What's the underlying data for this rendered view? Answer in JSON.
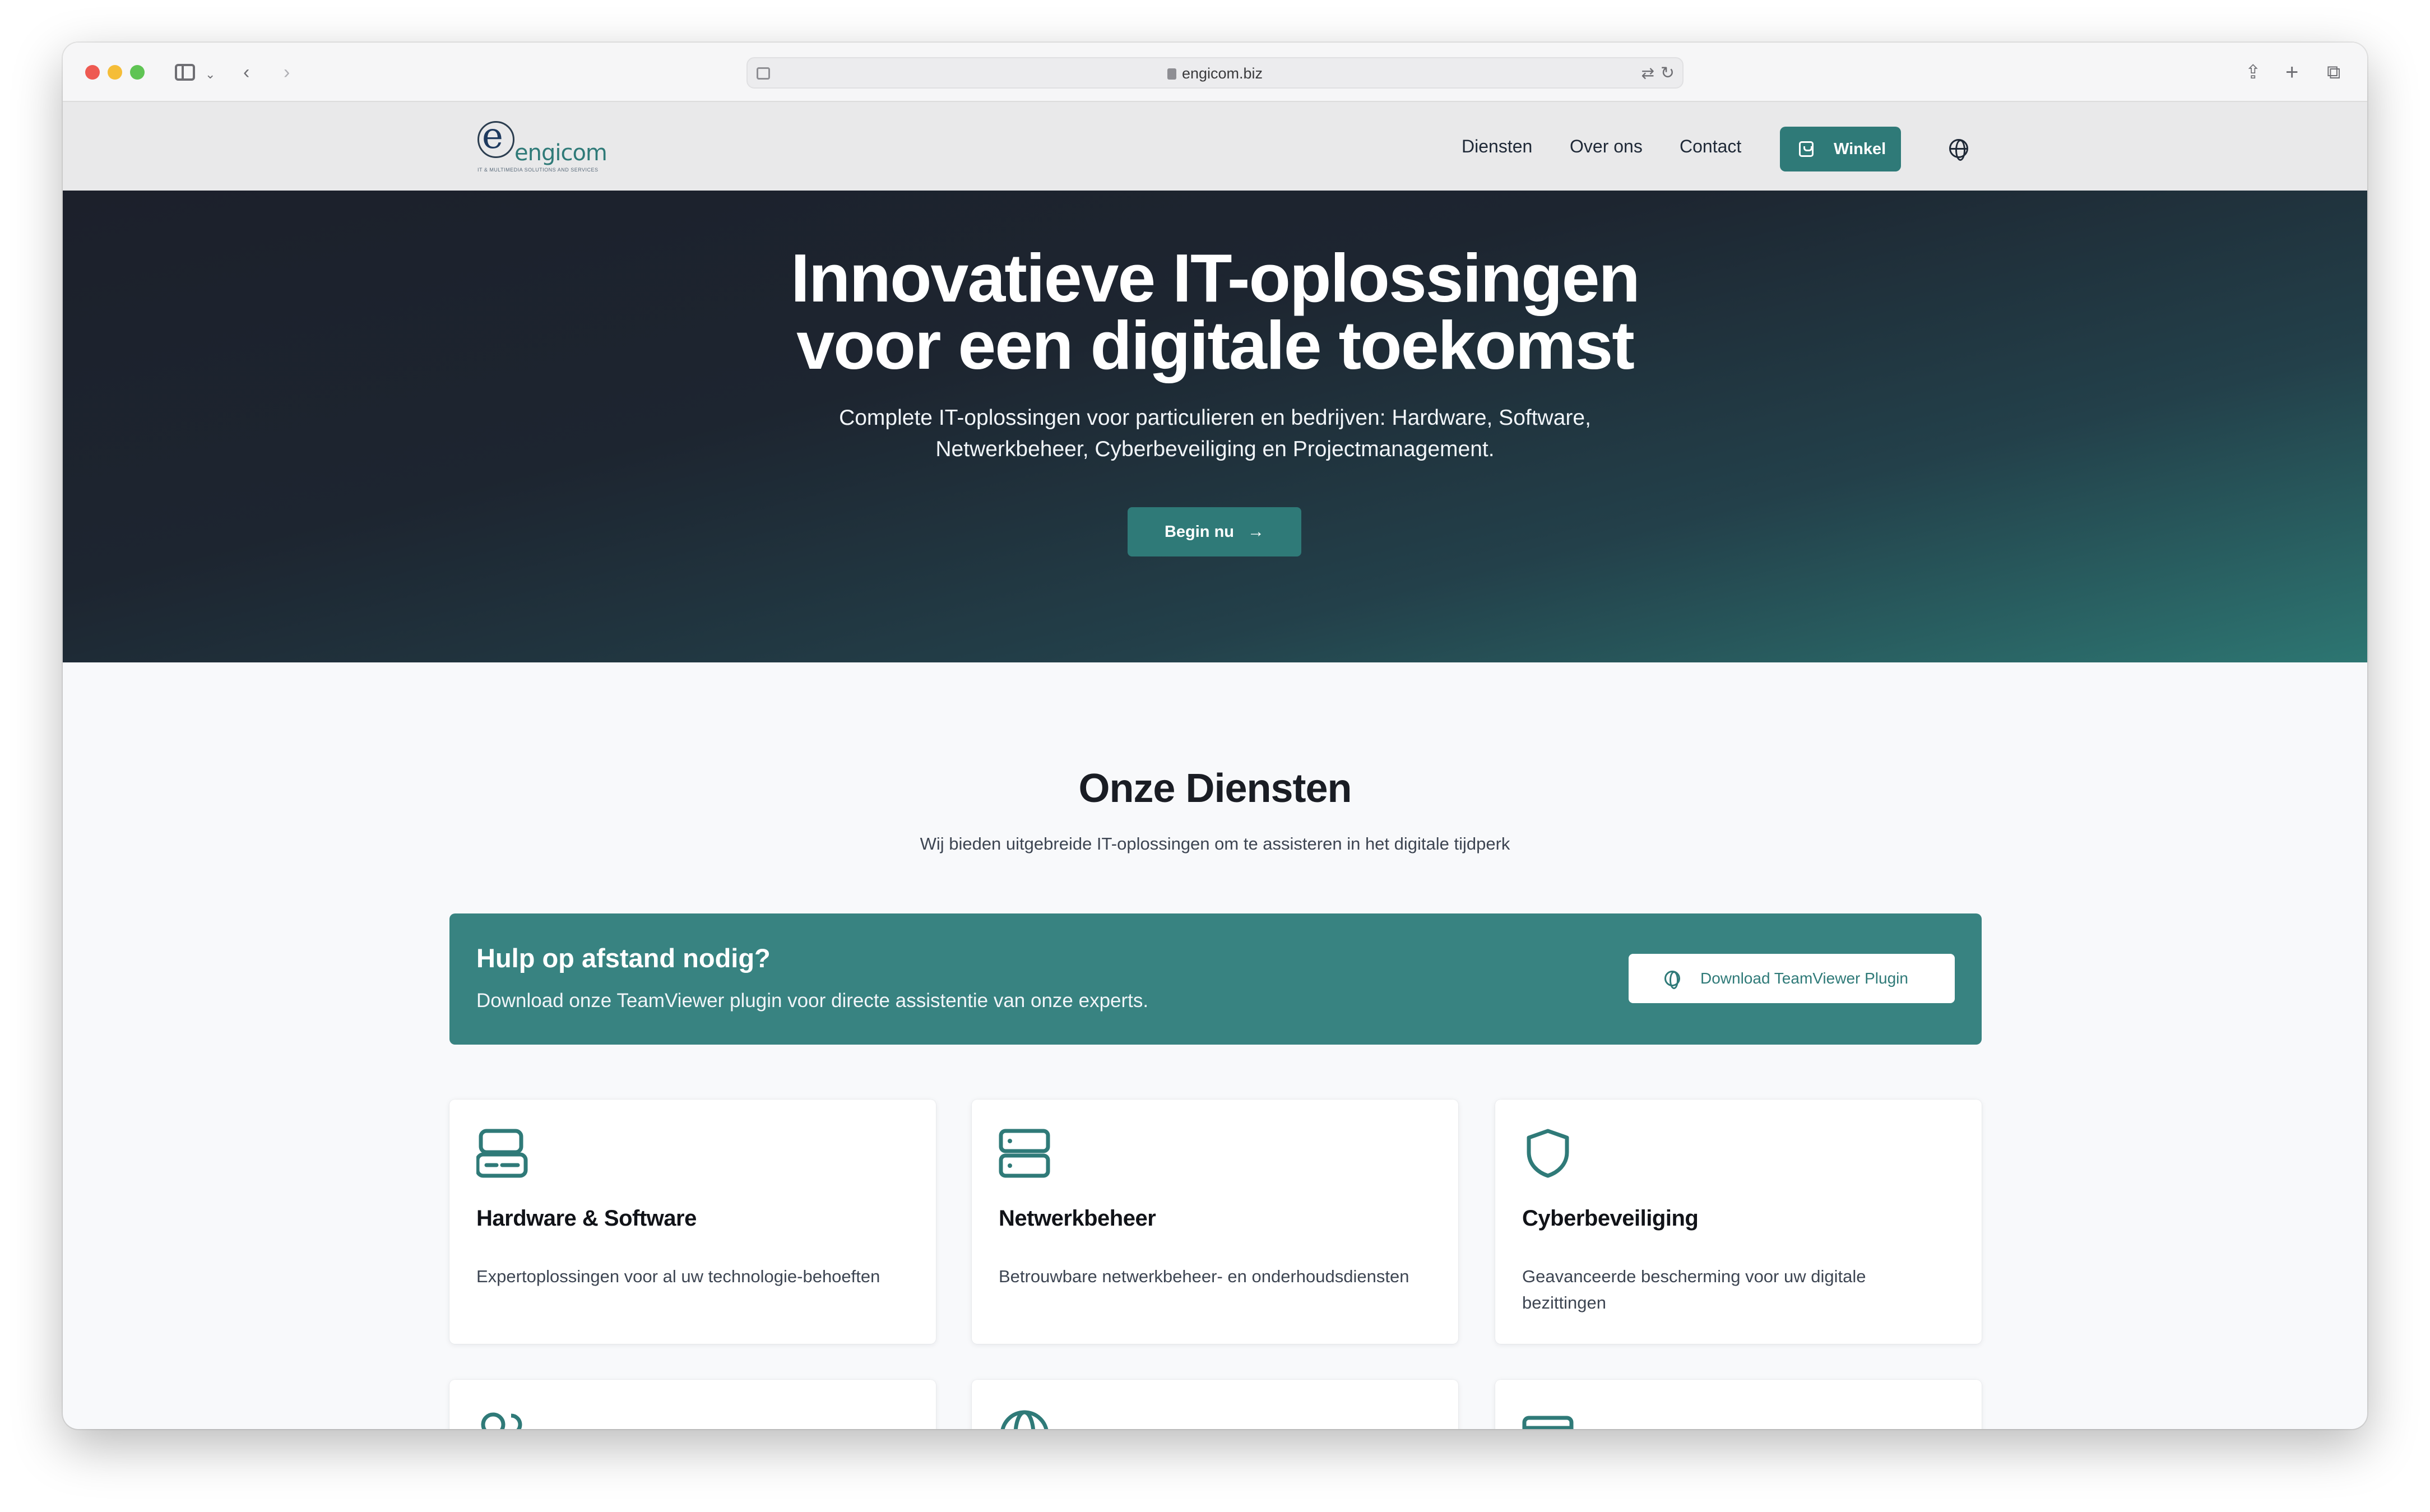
{
  "browser": {
    "url": "engicom.biz"
  },
  "header": {
    "logo_text": "engicom",
    "logo_tagline": "IT & MULTIMEDIA SOLUTIONS AND SERVICES",
    "nav": {
      "diensten": "Diensten",
      "over": "Over ons",
      "contact": "Contact"
    },
    "shop_label": "Winkel"
  },
  "hero": {
    "title_line1": "Innovatieve IT-oplossingen",
    "title_line2": "voor een digitale toekomst",
    "subtitle_line1": "Complete IT-oplossingen voor particulieren en bedrijven: Hardware, Software,",
    "subtitle_line2": "Netwerkbeheer, Cyberbeveiliging en Projectmanagement.",
    "cta_label": "Begin nu"
  },
  "services": {
    "title": "Onze Diensten",
    "subtitle": "Wij bieden uitgebreide IT-oplossingen om te assisteren in het digitale tijdperk",
    "banner": {
      "title": "Hulp op afstand nodig?",
      "text": "Download onze TeamViewer plugin voor directe assistentie van onze experts.",
      "button_label": "Download TeamViewer Plugin"
    },
    "cards": [
      {
        "title": "Hardware & Software",
        "text": "Expertoplossingen voor al uw technologie-behoeften",
        "icon": "hardware-icon"
      },
      {
        "title": "Netwerkbeheer",
        "text": "Betrouwbare netwerkbeheer- en onderhoudsdiensten",
        "icon": "server-icon"
      },
      {
        "title": "Cyberbeveiliging",
        "text": "Geavanceerde bescherming voor uw digitale bezittingen",
        "icon": "shield-icon"
      }
    ]
  },
  "colors": {
    "accent": "#2f7a78",
    "banner": "#388381",
    "hero_dark": "#1c202b"
  }
}
